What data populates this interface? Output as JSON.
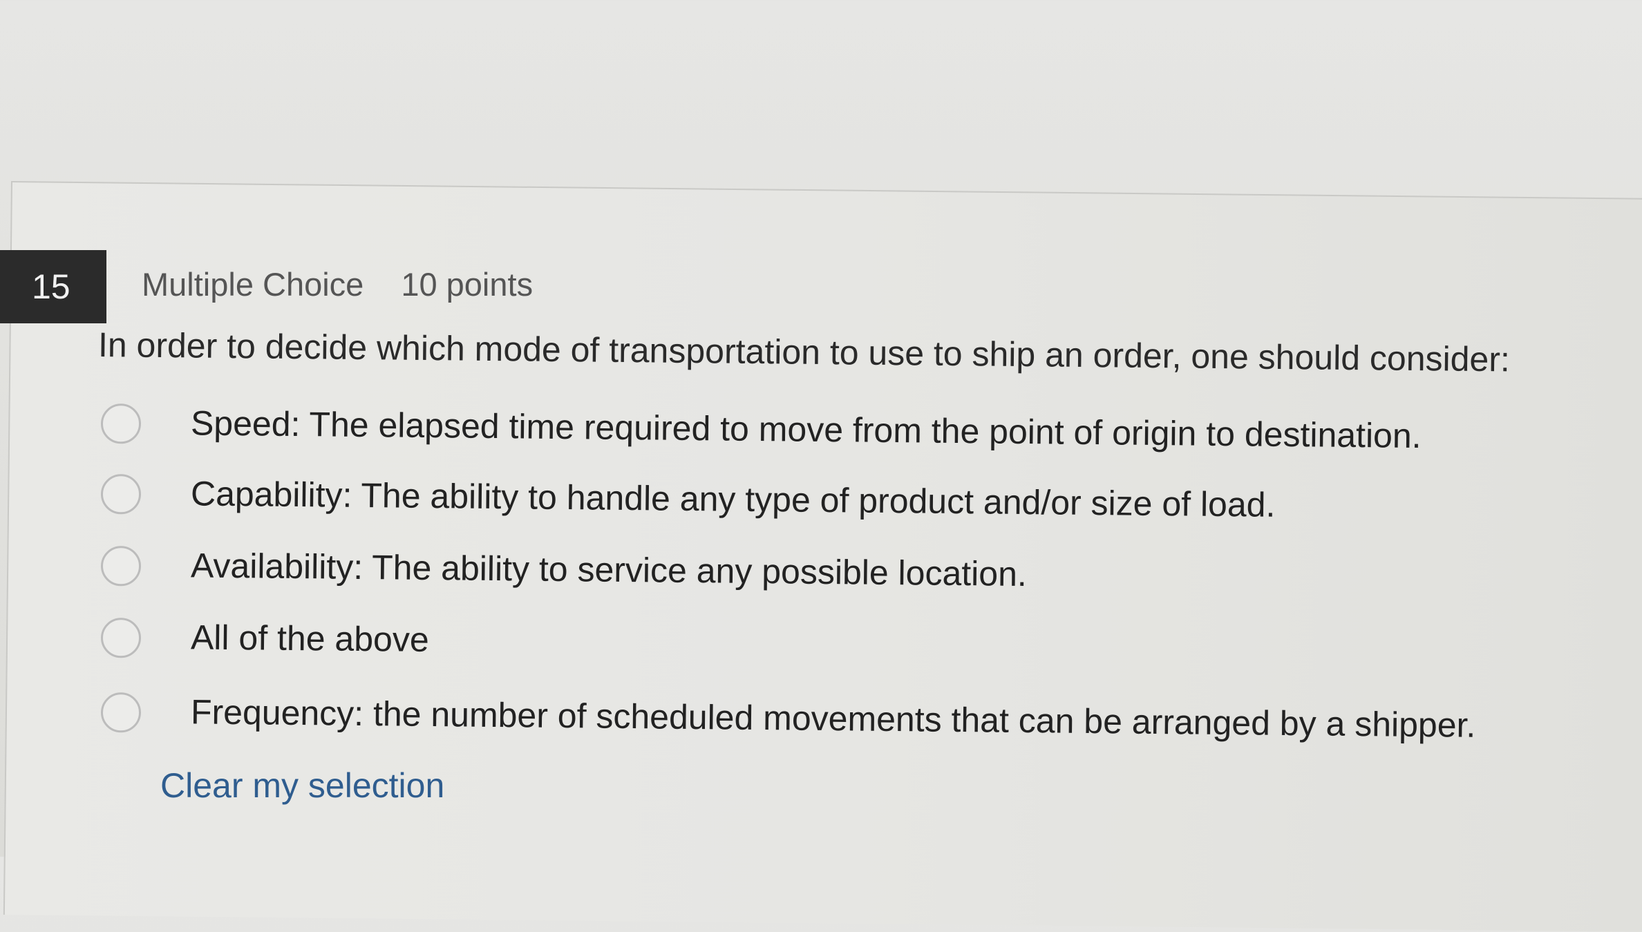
{
  "question": {
    "number": "15",
    "type": "Multiple Choice",
    "points": "10 points",
    "prompt": "In order to decide which mode of transportation to use to ship an order, one should consider:"
  },
  "options": [
    {
      "label": "Speed: The elapsed time required to move from the point of origin to destination.",
      "selected": false
    },
    {
      "label": "Capability: The ability to handle any type of product and/or size of load.",
      "selected": false
    },
    {
      "label": "Availability: The ability to service any possible location.",
      "selected": false
    },
    {
      "label": "All of the above",
      "selected": false
    },
    {
      "label": "Frequency: the number of scheduled movements that can be arranged by a shipper.",
      "selected": false
    }
  ],
  "actions": {
    "clear_label": "Clear my selection"
  },
  "colors": {
    "number_badge": "#2b2b2b",
    "link": "#2f5d8f"
  }
}
